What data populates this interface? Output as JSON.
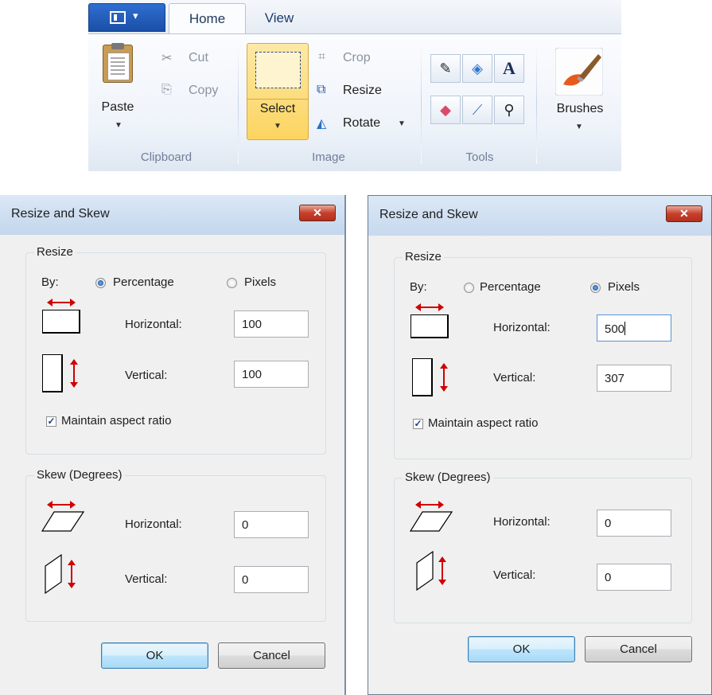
{
  "ribbon": {
    "tabs": [
      "Home",
      "View"
    ],
    "clipboard": {
      "paste": "Paste",
      "cut": "Cut",
      "copy": "Copy",
      "group": "Clipboard"
    },
    "image": {
      "select": "Select",
      "crop": "Crop",
      "resize": "Resize",
      "rotate": "Rotate",
      "group": "Image"
    },
    "tools": {
      "group": "Tools"
    },
    "brushes": {
      "label": "Brushes"
    }
  },
  "dialogs": [
    {
      "title": "Resize and Skew",
      "close": "✕",
      "resize": {
        "legend": "Resize",
        "by_label": "By:",
        "percentage_label": "Percentage",
        "pixels_label": "Pixels",
        "selected": "Percentage",
        "horizontal_label": "Horizontal:",
        "horizontal_value": "100",
        "vertical_label": "Vertical:",
        "vertical_value": "100",
        "maintain_label": "Maintain aspect ratio",
        "maintain_checked": true
      },
      "skew": {
        "legend": "Skew (Degrees)",
        "horizontal_label": "Horizontal:",
        "horizontal_value": "0",
        "vertical_label": "Vertical:",
        "vertical_value": "0"
      },
      "ok_label": "OK",
      "cancel_label": "Cancel"
    },
    {
      "title": "Resize and Skew",
      "close": "✕",
      "resize": {
        "legend": "Resize",
        "by_label": "By:",
        "percentage_label": "Percentage",
        "pixels_label": "Pixels",
        "selected": "Pixels",
        "horizontal_label": "Horizontal:",
        "horizontal_value": "500",
        "vertical_label": "Vertical:",
        "vertical_value": "307",
        "maintain_label": "Maintain aspect ratio",
        "maintain_checked": true
      },
      "skew": {
        "legend": "Skew (Degrees)",
        "horizontal_label": "Horizontal:",
        "horizontal_value": "0",
        "vertical_label": "Vertical:",
        "vertical_value": "0"
      },
      "ok_label": "OK",
      "cancel_label": "Cancel"
    }
  ]
}
